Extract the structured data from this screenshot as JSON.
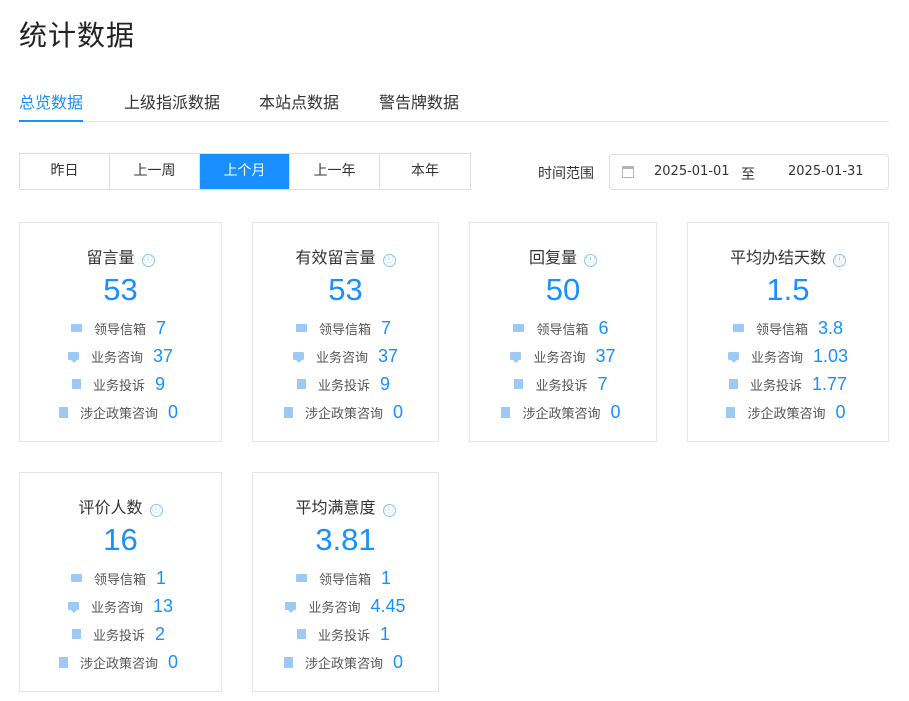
{
  "page": {
    "title": "统计数据"
  },
  "tabs": [
    {
      "label": "总览数据",
      "active": true
    },
    {
      "label": "上级指派数据",
      "active": false
    },
    {
      "label": "本站点数据",
      "active": false
    },
    {
      "label": "警告牌数据",
      "active": false
    }
  ],
  "periods": [
    {
      "label": "昨日",
      "active": false
    },
    {
      "label": "上一周",
      "active": false
    },
    {
      "label": "上个月",
      "active": true
    },
    {
      "label": "上一年",
      "active": false
    },
    {
      "label": "本年",
      "active": false
    }
  ],
  "date_range": {
    "label": "时间范围",
    "start": "2025-01-01",
    "separator": "至",
    "end": "2025-01-31",
    "icon": "calendar-icon"
  },
  "row_labels": [
    "领导信箱",
    "业务咨询",
    "业务投诉",
    "涉企政策咨询"
  ],
  "row_icons": [
    "mail-icon",
    "chat-icon",
    "complaint-icon",
    "policy-file-icon"
  ],
  "info_icon": "ⓘ",
  "cards": [
    {
      "title": "留言量",
      "value": "53",
      "rows": [
        "7",
        "37",
        "9",
        "0"
      ]
    },
    {
      "title": "有效留言量",
      "value": "53",
      "rows": [
        "7",
        "37",
        "9",
        "0"
      ]
    },
    {
      "title": "回复量",
      "value": "50",
      "rows": [
        "6",
        "37",
        "7",
        "0"
      ]
    },
    {
      "title": "平均办结天数",
      "value": "1.5",
      "rows": [
        "3.8",
        "1.03",
        "1.77",
        "0"
      ]
    },
    {
      "title": "评价人数",
      "value": "16",
      "rows": [
        "1",
        "13",
        "2",
        "0"
      ]
    },
    {
      "title": "平均满意度",
      "value": "3.81",
      "rows": [
        "1",
        "4.45",
        "1",
        "0"
      ]
    }
  ],
  "colors": {
    "accent": "#1890ff",
    "icon": "#9ccaf5"
  }
}
